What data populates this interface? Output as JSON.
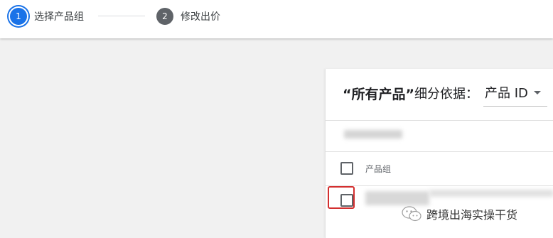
{
  "stepper": {
    "steps": [
      {
        "number": "1",
        "label": "选择产品组",
        "state": "active"
      },
      {
        "number": "2",
        "label": "修改出价",
        "state": "inactive"
      }
    ]
  },
  "panel": {
    "title_quoted": "“所有产品”",
    "title_suffix": "细分依据：",
    "dimension_select": {
      "value": "产品 ID"
    },
    "table": {
      "column_header": "产品组"
    }
  },
  "watermark": {
    "text": "跨境出海实操干货",
    "icon": "wechat-icon"
  },
  "colors": {
    "accent": "#1a73e8",
    "highlight": "#d32f2f",
    "step_inactive": "#5f6368"
  }
}
